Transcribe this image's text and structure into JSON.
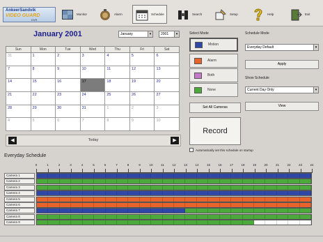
{
  "logo": {
    "line1": "AnkeerSandvik",
    "line2": "VIDEO GUARD",
    "line3": "DVR"
  },
  "toolbar": [
    {
      "label": "Monitor",
      "icon": "monitor-icon"
    },
    {
      "label": "Alarm",
      "icon": "alarm-icon"
    },
    {
      "label": "Schedule",
      "icon": "schedule-icon",
      "active": true
    },
    {
      "label": "Search",
      "icon": "binoculars-icon"
    },
    {
      "label": "Setup",
      "icon": "setup-icon"
    },
    {
      "label": "Help",
      "icon": "help-icon"
    },
    {
      "label": "Exit",
      "icon": "exit-icon"
    }
  ],
  "calendar": {
    "title": "January 2001",
    "month_select": "January",
    "year_select": "2001",
    "weekdays": [
      "Sun",
      "Mon",
      "Tue",
      "Wed",
      "Thu",
      "Fri",
      "Sat"
    ],
    "weeks": [
      [
        "31",
        "1",
        "2",
        "3",
        "4",
        "5",
        "6"
      ],
      [
        "7",
        "8",
        "9",
        "10",
        "11",
        "12",
        "13"
      ],
      [
        "14",
        "15",
        "16",
        "17",
        "18",
        "19",
        "20"
      ],
      [
        "21",
        "22",
        "23",
        "24",
        "25",
        "26",
        "27"
      ],
      [
        "28",
        "29",
        "30",
        "31",
        "1",
        "2",
        "3"
      ],
      [
        "4",
        "5",
        "6",
        "7",
        "8",
        "9",
        "10"
      ]
    ],
    "today_label": "Today"
  },
  "modes": {
    "label": "Select Mode",
    "items": [
      {
        "label": "Motion",
        "color": "#2f48a8"
      },
      {
        "label": "Alarm",
        "color": "#e8632b"
      },
      {
        "label": "Both",
        "color": "#c47ac9"
      },
      {
        "label": "None",
        "color": "#4caa3c"
      }
    ],
    "set_all": "Set All Cameras",
    "record": "Record",
    "auto_label": "Automatically set this schedule on startup"
  },
  "right": {
    "schedule_mode_label": "Schedule Mode",
    "schedule_mode_value": "Everyday Default",
    "apply": "Apply",
    "show_schedule_label": "Show Schedule",
    "show_schedule_value": "Current Day Only",
    "view": "View"
  },
  "schedule": {
    "title": "Everyday Schedule",
    "hours": [
      "0",
      "1",
      "2",
      "3",
      "4",
      "5",
      "6",
      "7",
      "8",
      "9",
      "10",
      "11",
      "12",
      "13",
      "14",
      "15",
      "16",
      "17",
      "18",
      "19",
      "20",
      "21",
      "22",
      "23",
      "24"
    ],
    "colors": {
      "motion": "#2f48a8",
      "alarm": "#e8632b",
      "none": "#4caa3c",
      "off": "#ffffff"
    },
    "cameras": [
      {
        "label": "Camera 1",
        "segments": [
          {
            "mode": "motion",
            "hours": 24
          }
        ]
      },
      {
        "label": "Camera 2",
        "segments": [
          {
            "mode": "none",
            "hours": 24
          }
        ]
      },
      {
        "label": "Camera 3",
        "segments": [
          {
            "mode": "none",
            "hours": 24
          }
        ]
      },
      {
        "label": "Camera 4",
        "segments": [
          {
            "mode": "motion",
            "hours": 24
          }
        ]
      },
      {
        "label": "Camera 5",
        "segments": [
          {
            "mode": "alarm",
            "hours": 24
          }
        ]
      },
      {
        "label": "Camera 6",
        "segments": [
          {
            "mode": "alarm",
            "hours": 24
          }
        ]
      },
      {
        "label": "Camera 7",
        "segments": [
          {
            "mode": "motion",
            "hours": 13
          },
          {
            "mode": "none",
            "hours": 11
          }
        ]
      },
      {
        "label": "Camera 8",
        "segments": [
          {
            "mode": "none",
            "hours": 24
          }
        ]
      },
      {
        "label": "Camera 9",
        "segments": [
          {
            "mode": "none",
            "hours": 19
          },
          {
            "mode": "off",
            "hours": 5
          }
        ]
      }
    ]
  }
}
